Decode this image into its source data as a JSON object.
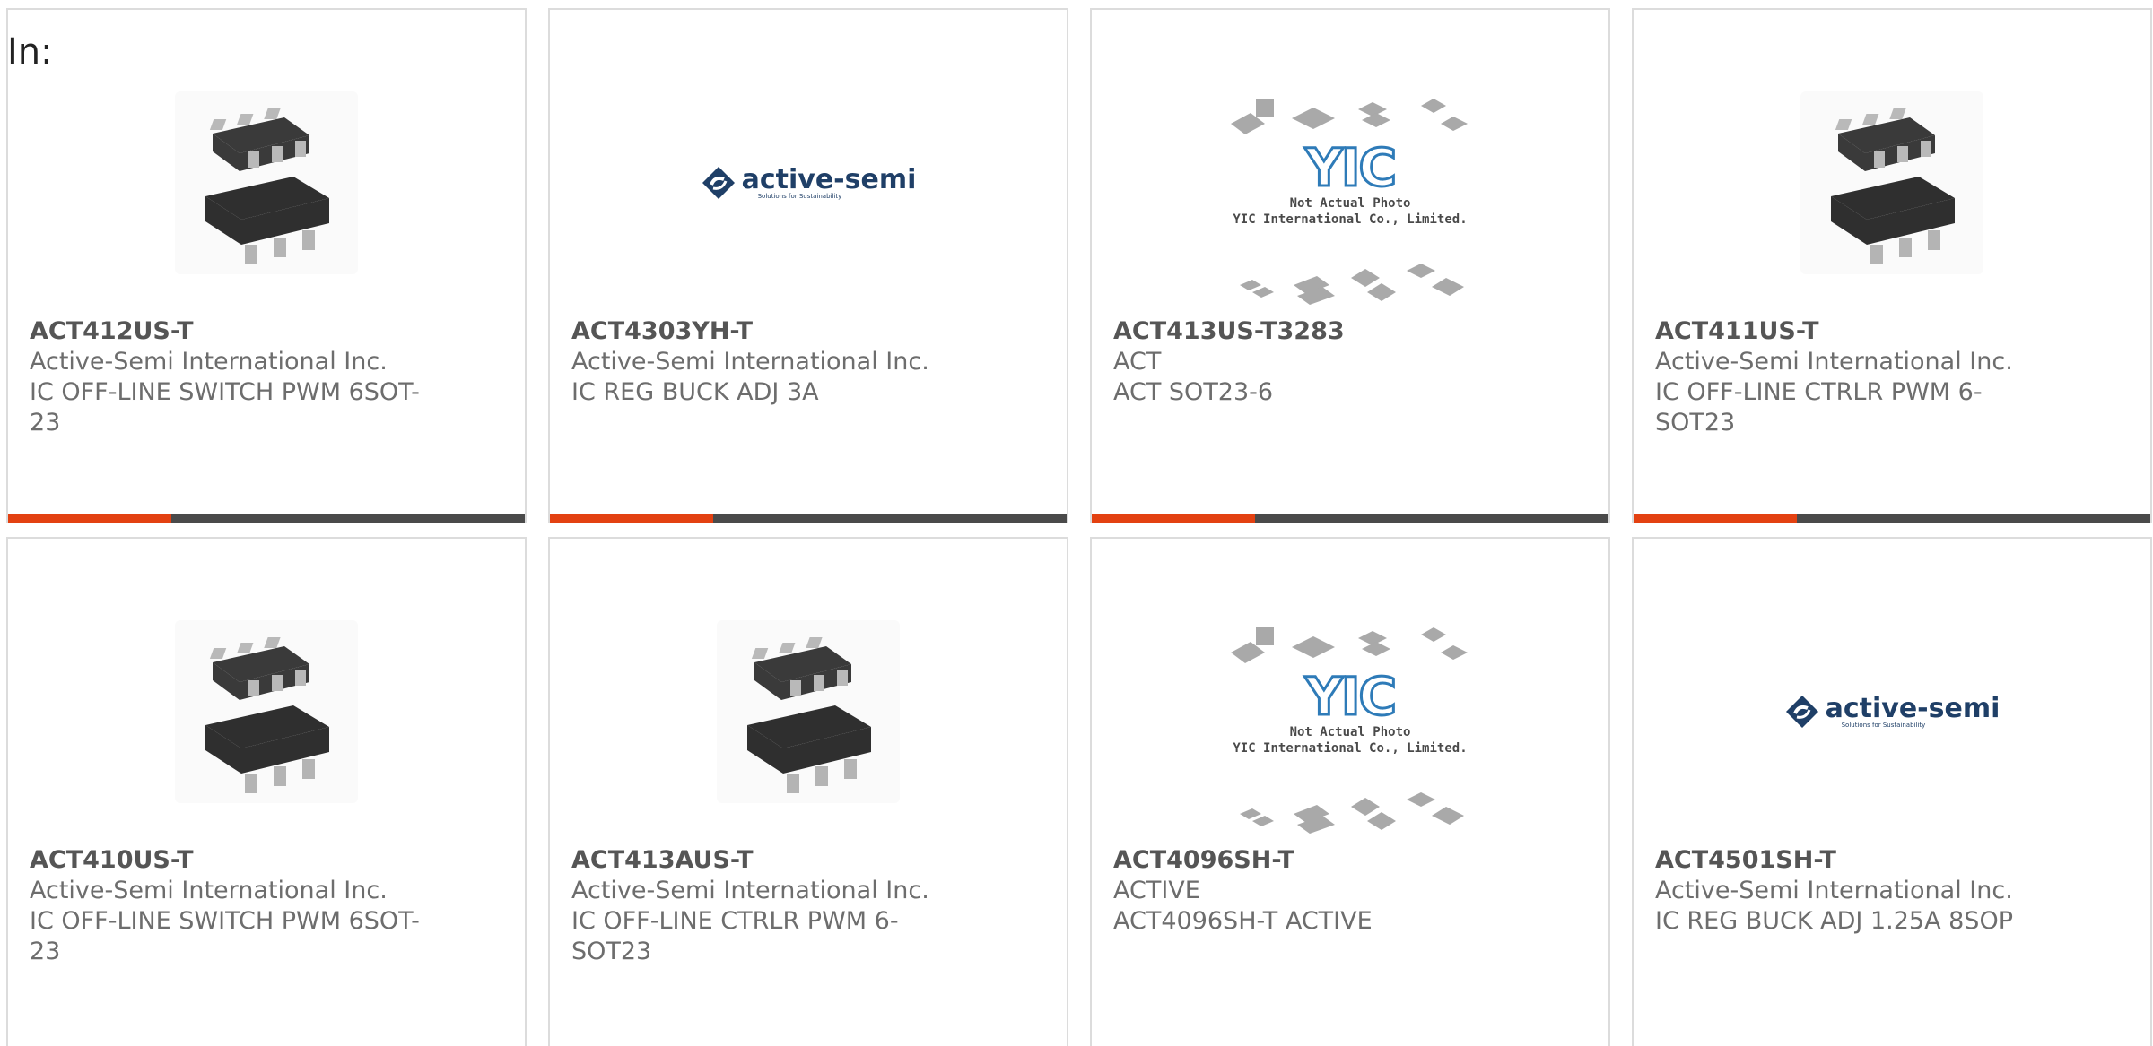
{
  "header": {
    "in_label": "In:"
  },
  "colors": {
    "accent": "#e34111",
    "bar": "#4a4a4a",
    "border": "#dcdcdc",
    "text": "#6d6d6d"
  },
  "products": [
    {
      "part_number": "ACT412US-T",
      "manufacturer": "Active-Semi International Inc.",
      "description": "IC OFF-LINE SWITCH PWM 6SOT-23",
      "image": "sot23-chip-icon"
    },
    {
      "part_number": "ACT4303YH-T",
      "manufacturer": "Active-Semi International Inc.",
      "description": "IC REG BUCK ADJ 3A",
      "image": "active-semi-logo",
      "logo_text": "active-semi",
      "logo_tagline": "Solutions for Sustainability"
    },
    {
      "part_number": "ACT413US-T3283",
      "manufacturer": "ACT",
      "description": "ACT SOT23-6",
      "image": "yic-placeholder-icon",
      "placeholder_logo": "YIC",
      "placeholder_line1": "Not Actual Photo",
      "placeholder_line2": "YIC International Co., Limited."
    },
    {
      "part_number": "ACT411US-T",
      "manufacturer": "Active-Semi International Inc.",
      "description": "IC OFF-LINE CTRLR PWM 6-SOT23",
      "image": "sot23-chip-icon"
    },
    {
      "part_number": "ACT410US-T",
      "manufacturer": "Active-Semi International Inc.",
      "description": "IC OFF-LINE SWITCH PWM 6SOT-23",
      "image": "sot23-chip-icon"
    },
    {
      "part_number": "ACT413AUS-T",
      "manufacturer": "Active-Semi International Inc.",
      "description": "IC OFF-LINE CTRLR PWM 6-SOT23",
      "image": "sot23-chip-icon"
    },
    {
      "part_number": "ACT4096SH-T",
      "manufacturer": "ACTIVE",
      "description": "ACT4096SH-T ACTIVE",
      "image": "yic-placeholder-icon",
      "placeholder_logo": "YIC",
      "placeholder_line1": "Not Actual Photo",
      "placeholder_line2": "YIC International Co., Limited."
    },
    {
      "part_number": "ACT4501SH-T",
      "manufacturer": "Active-Semi International Inc.",
      "description": "IC REG BUCK ADJ 1.25A 8SOP",
      "image": "active-semi-logo",
      "logo_text": "active-semi",
      "logo_tagline": "Solutions for Sustainability"
    }
  ]
}
